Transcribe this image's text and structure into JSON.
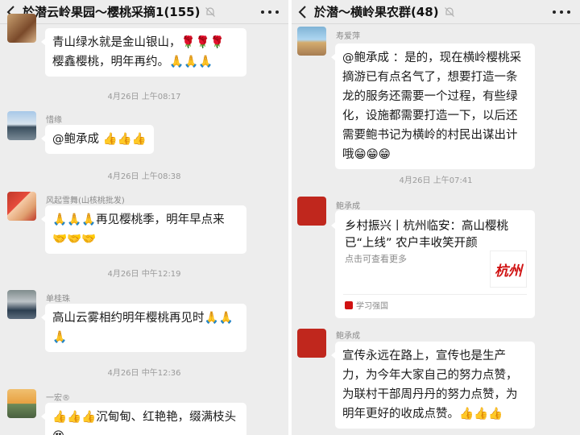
{
  "left": {
    "title": "於潜云岭果园～樱桃采摘1(155)",
    "messages": [
      {
        "sender": "",
        "text": "青山绿水就是金山银山，🌹🌹🌹 樱鑫樱桃，明年再约。🙏🙏🙏"
      },
      {
        "timestamp": "4月26日 上午08:17"
      },
      {
        "sender": "惜缘",
        "text": "@鲍承成 👍👍👍"
      },
      {
        "timestamp": "4月26日 上午08:38"
      },
      {
        "sender": "风起雪舞(山核桃批发)",
        "text": "🙏🙏🙏再见樱桃季，明年早点来 🤝🤝🤝"
      },
      {
        "timestamp": "4月26日 中午12:19"
      },
      {
        "sender": "单桂珠",
        "text": "高山云雾相约明年樱桃再见时🙏🙏🙏"
      },
      {
        "timestamp": "4月26日 中午12:36"
      },
      {
        "sender": "一宏®",
        "text": "👍👍👍沉甸甸、红艳艳，缀满枝头 😍"
      }
    ]
  },
  "right": {
    "title": "於潜～横岭果农群(48)",
    "messages": [
      {
        "sender": "寿爱萍",
        "text": "@鲍承成 ：是的，现在横岭樱桃采摘游已有点名气了，想要打造一条龙的服务还需要一个过程，有些绿化，设施都需要打造一下，以后还需要鲍书记为横岭的村民出谋出计哦😁😁😁"
      },
      {
        "timestamp": "4月26日 上午07:41"
      },
      {
        "sender": "鲍承成",
        "card": {
          "title": "乡村振兴丨杭州临安：高山樱桃已“上线” 农户丰收笑开颜",
          "desc": "点击可查看更多",
          "thumb_text": "杭州",
          "source": "学习强国"
        }
      },
      {
        "sender": "鲍承成",
        "text": "宣传永远在路上，宣传也是生产力，为今年大家自己的努力点赞，为联村干部周丹丹的努力点赞，为明年更好的收成点赞。👍👍👍"
      }
    ]
  },
  "icons": {
    "back": "chevron-left-icon",
    "mute": "bell-off-icon",
    "more": "more-dots-icon"
  },
  "colors": {
    "bg": "#ededed",
    "bubble": "#ffffff",
    "accent_red": "#d01212"
  }
}
